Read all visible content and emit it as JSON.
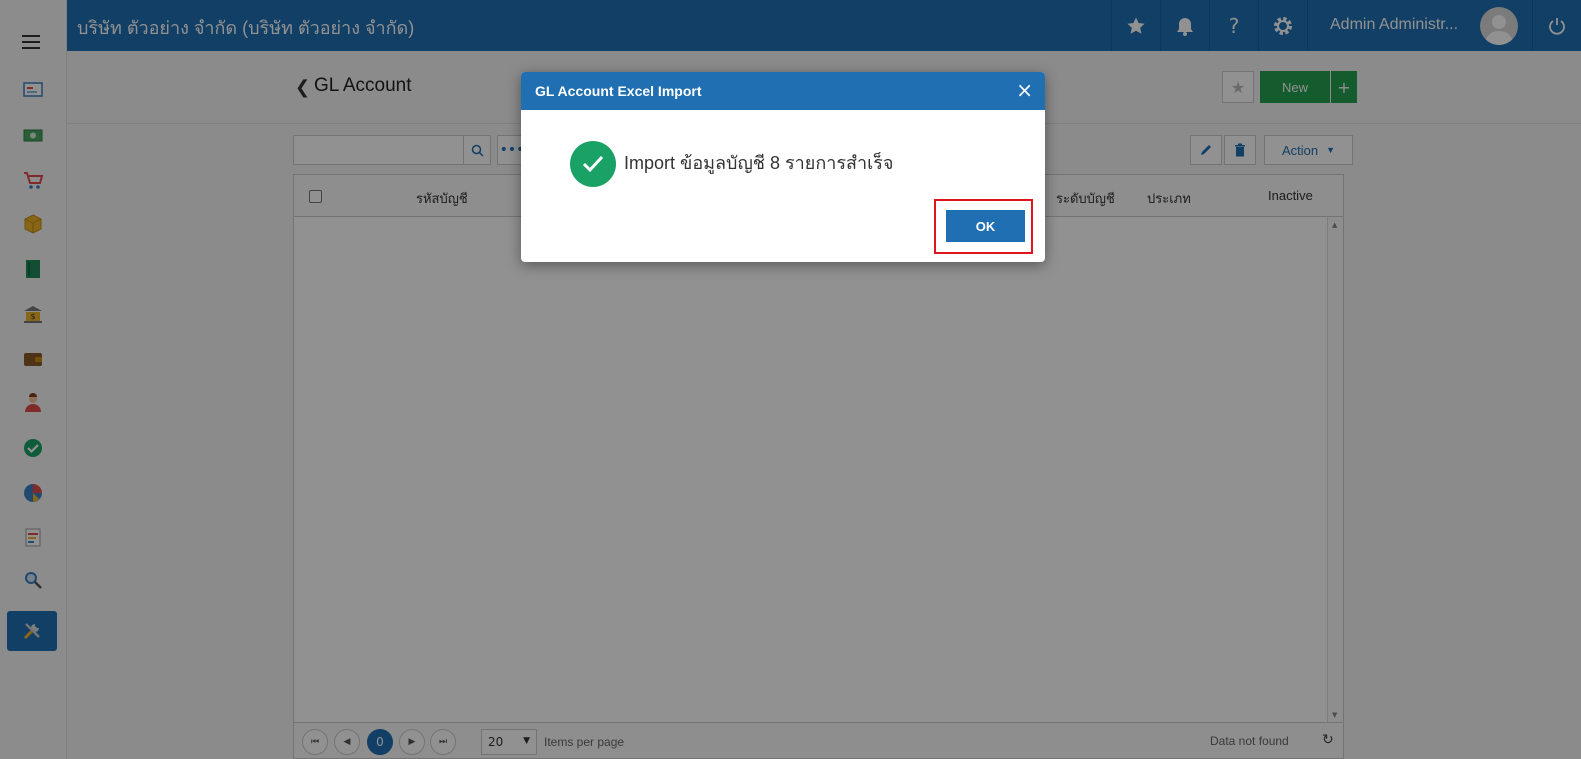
{
  "topbar": {
    "company": "บริษัท ตัวอย่าง จำกัด (บริษัท ตัวอย่าง จำกัด)",
    "user_name": "Admin Administr...",
    "help_label": "?"
  },
  "page": {
    "title": "GL Account",
    "new_label": "New",
    "new_plus": "+",
    "action_label": "Action",
    "more_label": "•••"
  },
  "grid": {
    "columns": [
      "รหัสบัญชี",
      "ระดับบัญชี",
      "ประเภท",
      "Inactive"
    ],
    "page_size": "20",
    "current_page": "0",
    "items_per_page": "Items per page",
    "no_data": "Data not found"
  },
  "dialog": {
    "title": "GL Account Excel Import",
    "close": "×",
    "message": "Import ข้อมูลบัญชี 8 รายการสำเร็จ",
    "ok_label": "OK"
  },
  "colors": {
    "primary": "#1f6fb2",
    "success": "#1aa266",
    "new_button": "#24a14f",
    "highlight": "#e0161f"
  }
}
